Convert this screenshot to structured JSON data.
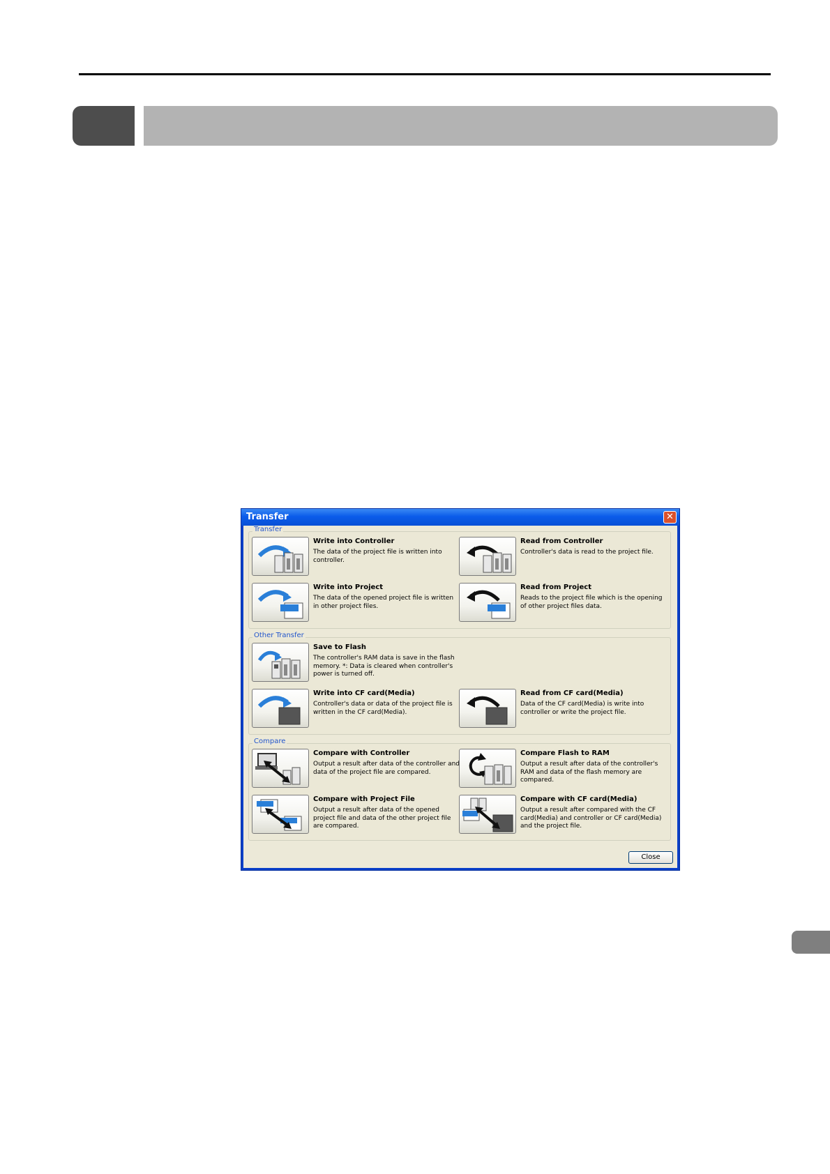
{
  "dialog": {
    "title": "Transfer",
    "close_glyph": "✕",
    "close_label": "Close"
  },
  "groups": [
    {
      "label": "Transfer",
      "items": [
        {
          "title": "Write into Controller",
          "desc": "The data of the project file is written into controller.",
          "icon": "write-to-controller-icon"
        },
        {
          "title": "Read from Controller",
          "desc": "Controller's data is read to the project file.",
          "icon": "read-from-controller-icon"
        },
        {
          "title": "Write into Project",
          "desc": "The data of the opened project file is written in other project files.",
          "icon": "write-to-project-icon"
        },
        {
          "title": "Read from Project",
          "desc": "Reads to the project file which is the opening of other project files data.",
          "icon": "read-from-project-icon"
        }
      ]
    },
    {
      "label": "Other Transfer",
      "items": [
        {
          "title": "Save to Flash",
          "desc": "The controller's RAM data is save in the flash memory. *: Data is cleared when controller's power is turned off.",
          "icon": "save-to-flash-icon"
        },
        {
          "title": "Write into CF card(Media)",
          "desc": "Controller's data or data of the project file is written in the CF card(Media).",
          "icon": "write-to-cf-card-icon"
        },
        {
          "title": "Read from CF card(Media)",
          "desc": "Data of the CF card(Media) is write into controller or write the project file.",
          "icon": "read-from-cf-card-icon"
        }
      ]
    },
    {
      "label": "Compare",
      "items": [
        {
          "title": "Compare with Controller",
          "desc": "Output a result after data of the controller and data of the project file are compared.",
          "icon": "compare-controller-icon"
        },
        {
          "title": "Compare Flash to RAM",
          "desc": "Output a result after data of the controller's RAM and data of the flash memory are compared.",
          "icon": "compare-flash-ram-icon"
        },
        {
          "title": "Compare with Project File",
          "desc": "Output a result after data of the opened project file and data of the other project file are compared.",
          "icon": "compare-project-file-icon"
        },
        {
          "title": "Compare with CF card(Media)",
          "desc": "Output a result after compared with the CF card(Media) and controller or CF card(Media) and the project file.",
          "icon": "compare-cf-card-icon"
        }
      ]
    }
  ]
}
